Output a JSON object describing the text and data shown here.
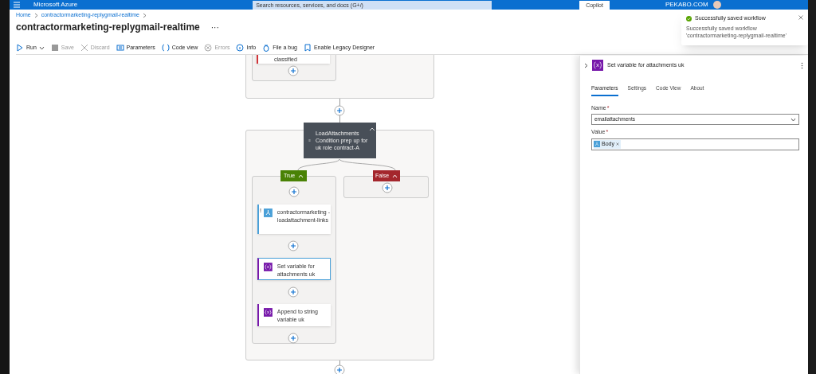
{
  "top_bar": {
    "brand": "Microsoft Azure",
    "search_placeholder": "Search resources, services, and docs (G+/)",
    "copilot": "Copilot",
    "account": "PEKABO.COM"
  },
  "breadcrumb": [
    "Home",
    "contractormarketing-replygmail-realtime"
  ],
  "title": "contractormarketing-replygmail-realtime",
  "more": "···",
  "toolbar": [
    {
      "kind": "run",
      "label": "Run",
      "disabled": false
    },
    {
      "kind": "save",
      "label": "Save",
      "disabled": true
    },
    {
      "kind": "discard",
      "label": "Discard",
      "disabled": true
    },
    {
      "kind": "parameters",
      "label": "Parameters",
      "disabled": false
    },
    {
      "kind": "code",
      "label": "Code view",
      "disabled": false
    },
    {
      "kind": "errors",
      "label": "Errors",
      "disabled": true
    },
    {
      "kind": "info",
      "label": "Info",
      "disabled": false
    },
    {
      "kind": "bug",
      "label": "File a bug",
      "disabled": false
    },
    {
      "kind": "legacy",
      "label": "Enable Legacy Designer",
      "disabled": false
    }
  ],
  "toast": {
    "title": "Successfully saved workflow",
    "message": "Successfully saved workflow 'contractormarketing-replygmail-realtime'"
  },
  "canvas": {
    "top_action": {
      "label": "classified",
      "failed": true
    },
    "condition": {
      "label": "LoadAttachments Condition prep up for uk role contract-A",
      "expanded": true
    },
    "branches": [
      {
        "label": "True",
        "expanded": true,
        "actions": [
          {
            "kind": "workflow",
            "label": "contractormarketing -loadattachment-links",
            "selected": false,
            "warning": "!"
          },
          {
            "kind": "variable",
            "label": "Set variable for attachments uk",
            "selected": true
          },
          {
            "kind": "variable",
            "label": "Append to string variable uk",
            "selected": false
          }
        ]
      },
      {
        "label": "False",
        "expanded": true
      }
    ]
  },
  "panel": {
    "title": "Set variable for attachments uk",
    "tabs": [
      {
        "label": "Parameters",
        "selected": true
      },
      {
        "label": "Settings",
        "selected": false
      },
      {
        "label": "Code View",
        "selected": false
      },
      {
        "label": "About",
        "selected": false
      }
    ],
    "name_label": "Name",
    "name_value": "emailattachments",
    "value_label": "Value",
    "required_mark": "*",
    "value_token": "Body"
  }
}
